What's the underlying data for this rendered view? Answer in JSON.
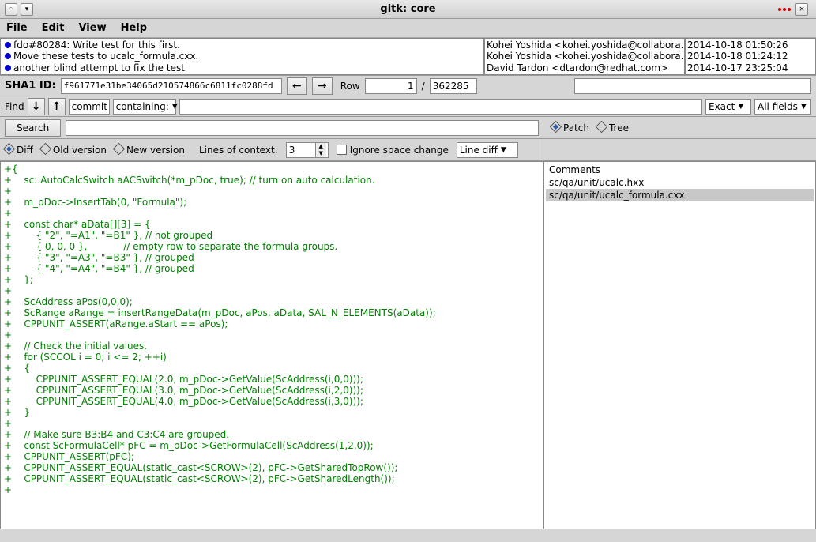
{
  "window": {
    "title": "gitk: core"
  },
  "menu": {
    "file": "File",
    "edit": "Edit",
    "view": "View",
    "help": "Help"
  },
  "commits": [
    {
      "msg": "fdo#80284: Write test for this first.",
      "author": "Kohei Yoshida <kohei.yoshida@collabora.com",
      "date": "2014-10-18 01:50:26"
    },
    {
      "msg": "Move these tests to ucalc_formula.cxx.",
      "author": "Kohei Yoshida <kohei.yoshida@collabora.com",
      "date": "2014-10-18 01:24:12"
    },
    {
      "msg": "another blind attempt to fix the test",
      "author": "David Tardon <dtardon@redhat.com>",
      "date": "2014-10-17 23:25:04"
    }
  ],
  "sha": {
    "label": "SHA1 ID:",
    "value": "f961771e31be34065d210574866c6811fc0288fd"
  },
  "nav": {
    "row_label": "Row",
    "row_value": "1",
    "sep": "/",
    "total": "362285"
  },
  "find": {
    "label": "Find",
    "mode": "commit",
    "scope": "containing:",
    "mode2": "Exact",
    "fields": "All fields"
  },
  "search": {
    "btn": "Search"
  },
  "patch": {
    "patch": "Patch",
    "tree": "Tree"
  },
  "opts": {
    "diff": "Diff",
    "old": "Old version",
    "new": "New version",
    "lines_label": "Lines of context:",
    "lines_value": "3",
    "ignore": "Ignore space change",
    "linediff": "Line diff"
  },
  "diff_lines": [
    "{",
    "    sc::AutoCalcSwitch aACSwitch(*m_pDoc, true); // turn on auto calculation.",
    "",
    "    m_pDoc->InsertTab(0, \"Formula\");",
    "",
    "    const char* aData[][3] = {",
    "        { \"2\", \"=A1\", \"=B1\" }, // not grouped",
    "        { 0, 0, 0 },            // empty row to separate the formula groups.",
    "        { \"3\", \"=A3\", \"=B3\" }, // grouped",
    "        { \"4\", \"=A4\", \"=B4\" }, // grouped",
    "    };",
    "",
    "    ScAddress aPos(0,0,0);",
    "    ScRange aRange = insertRangeData(m_pDoc, aPos, aData, SAL_N_ELEMENTS(aData));",
    "    CPPUNIT_ASSERT(aRange.aStart == aPos);",
    "",
    "    // Check the initial values.",
    "    for (SCCOL i = 0; i <= 2; ++i)",
    "    {",
    "        CPPUNIT_ASSERT_EQUAL(2.0, m_pDoc->GetValue(ScAddress(i,0,0)));",
    "        CPPUNIT_ASSERT_EQUAL(3.0, m_pDoc->GetValue(ScAddress(i,2,0)));",
    "        CPPUNIT_ASSERT_EQUAL(4.0, m_pDoc->GetValue(ScAddress(i,3,0)));",
    "    }",
    "",
    "    // Make sure B3:B4 and C3:C4 are grouped.",
    "    const ScFormulaCell* pFC = m_pDoc->GetFormulaCell(ScAddress(1,2,0));",
    "    CPPUNIT_ASSERT(pFC);",
    "    CPPUNIT_ASSERT_EQUAL(static_cast<SCROW>(2), pFC->GetSharedTopRow());",
    "    CPPUNIT_ASSERT_EQUAL(static_cast<SCROW>(2), pFC->GetSharedLength());",
    ""
  ],
  "files": {
    "comments": "Comments",
    "f1": "sc/qa/unit/ucalc.hxx",
    "f2": "sc/qa/unit/ucalc_formula.cxx"
  }
}
